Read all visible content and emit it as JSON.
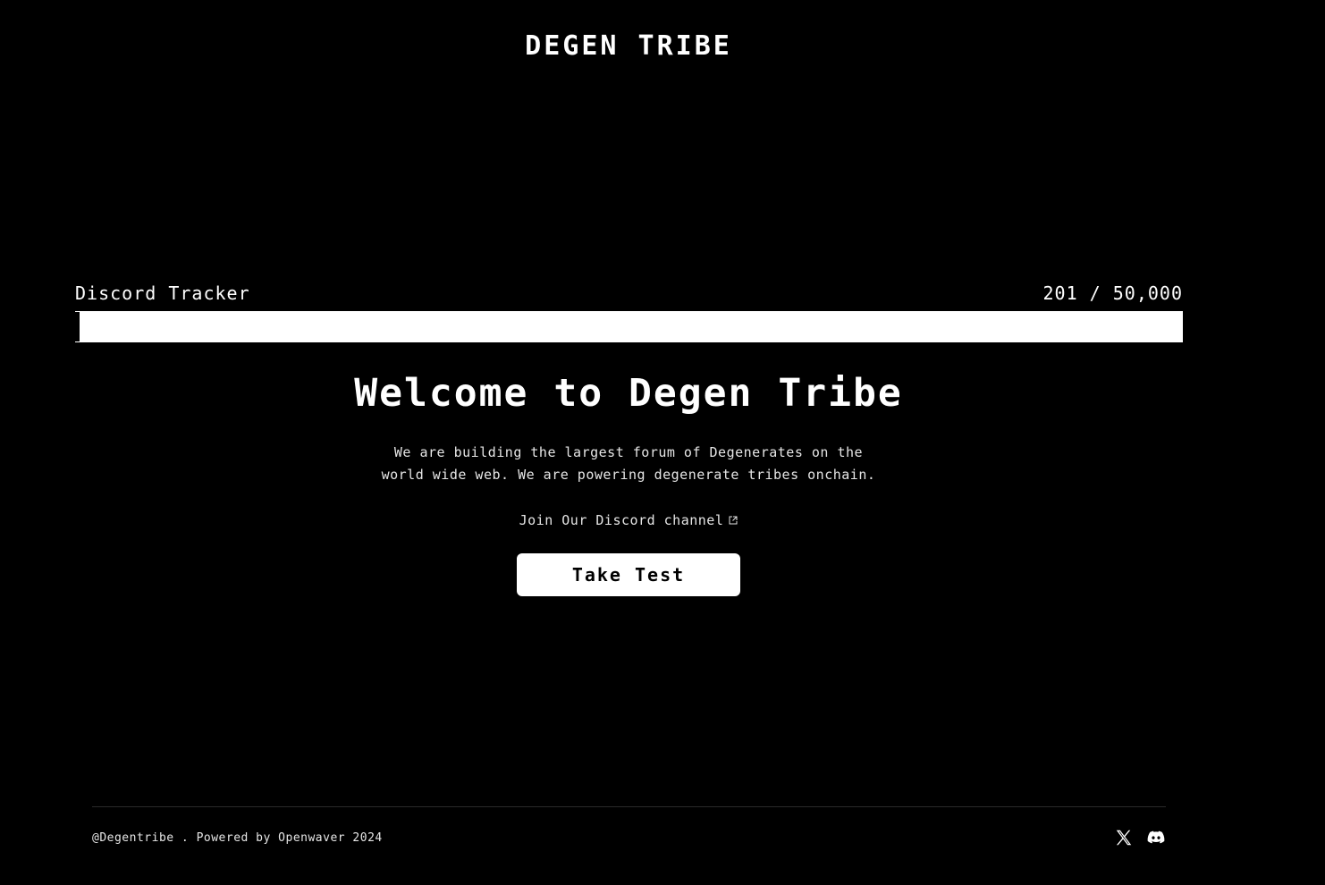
{
  "header": {
    "brand": "DEGEN TRIBE"
  },
  "tracker": {
    "label": "Discord Tracker",
    "count": "201 / 50,000",
    "current": 201,
    "goal": 50000
  },
  "hero": {
    "title": "Welcome to Degen Tribe",
    "description": "We are building the largest forum of Degenerates on the world wide web. We are powering degenerate tribes onchain.",
    "discord_link": "Join Our Discord channel",
    "cta": "Take Test"
  },
  "footer": {
    "text": "@Degentribe . Powered by Openwaver 2024",
    "socials": [
      {
        "icon": "x-icon"
      },
      {
        "icon": "discord-icon"
      }
    ]
  },
  "colors": {
    "background": "#000000",
    "foreground": "#ffffff",
    "muted": "#e6e6e6"
  }
}
